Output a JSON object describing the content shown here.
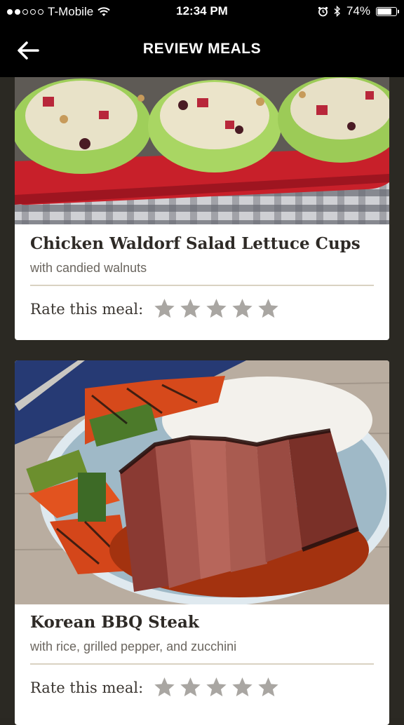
{
  "status_bar": {
    "carrier": "T-Mobile",
    "time": "12:34 PM",
    "battery": "74%",
    "signal_bars_filled": 2,
    "signal_bars_total": 5
  },
  "nav": {
    "title": "REVIEW MEALS",
    "back_icon": "back-arrow-icon"
  },
  "meals": [
    {
      "name": "Chicken Waldorf Salad Lettuce Cups",
      "subtitle": "with candied walnuts",
      "rate_label": "Rate this meal:",
      "rating": 0,
      "max_rating": 5
    },
    {
      "name": "Korean BBQ Steak",
      "subtitle": "with rice, grilled pepper, and zucchini",
      "rate_label": "Rate this meal:",
      "rating": 0,
      "max_rating": 5
    }
  ],
  "colors": {
    "star_empty": "#a9a6a2",
    "divider": "#d9d2c2",
    "background": "#2b2923"
  }
}
